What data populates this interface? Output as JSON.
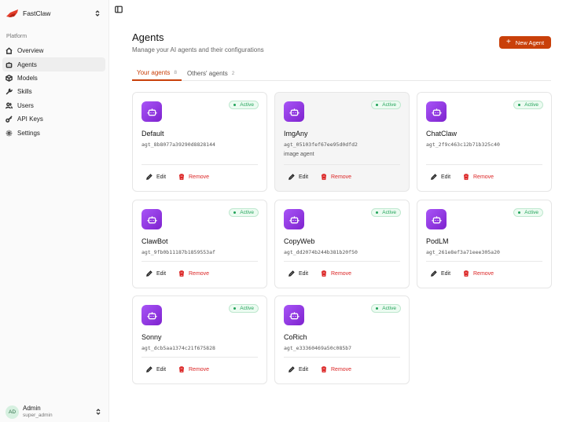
{
  "app": {
    "name": "FastClaw",
    "brand_color": "#c9400a"
  },
  "sidebar": {
    "section_label": "Platform",
    "items": [
      {
        "label": "Overview",
        "icon": "home-icon",
        "active": false
      },
      {
        "label": "Agents",
        "icon": "bot-icon",
        "active": true
      },
      {
        "label": "Models",
        "icon": "box-icon",
        "active": false
      },
      {
        "label": "Skills",
        "icon": "wrench-icon",
        "active": false
      },
      {
        "label": "Users",
        "icon": "users-icon",
        "active": false
      },
      {
        "label": "API Keys",
        "icon": "key-icon",
        "active": false
      },
      {
        "label": "Settings",
        "icon": "gear-icon",
        "active": false
      }
    ],
    "user": {
      "initials": "AD",
      "name": "Admin",
      "role": "super_admin"
    }
  },
  "header": {
    "title": "Agents",
    "subtitle": "Manage your AI agents and their configurations",
    "new_button": "New Agent"
  },
  "tabs": [
    {
      "label": "Your agents",
      "count": "8",
      "active": true
    },
    {
      "label": "Others' agents",
      "count": "2",
      "active": false
    }
  ],
  "card_actions": {
    "edit": "Edit",
    "remove": "Remove"
  },
  "agents": [
    {
      "name": "Default",
      "id": "agt_8b8077a39290d8828144",
      "status": "Active",
      "description": ""
    },
    {
      "name": "ImgAny",
      "id": "agt_05103fef67ee95d0dfd2",
      "status": "Active",
      "description": "image agent"
    },
    {
      "name": "ChatClaw",
      "id": "agt_2f9c463c12b71b325c40",
      "status": "Active",
      "description": ""
    },
    {
      "name": "ClawBot",
      "id": "agt_9fb0b11187b1859553af",
      "status": "Active",
      "description": ""
    },
    {
      "name": "CopyWeb",
      "id": "agt_dd2074b244b381b20f50",
      "status": "Active",
      "description": ""
    },
    {
      "name": "PodLM",
      "id": "agt_261e8ef3a71eee305a20",
      "status": "Active",
      "description": ""
    },
    {
      "name": "Sonny",
      "id": "agt_dcb5aa1374c21f675828",
      "status": "Active",
      "description": ""
    },
    {
      "name": "CoRich",
      "id": "agt_e33360469a50c085b7",
      "status": "Active",
      "description": ""
    }
  ]
}
